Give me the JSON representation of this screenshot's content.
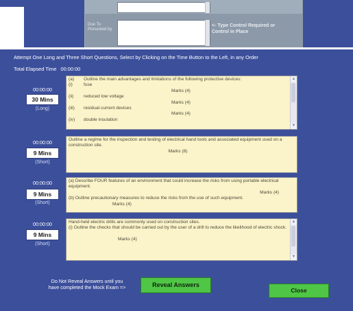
{
  "top": {
    "due_label": "Due To Presented by",
    "note": "<- Type Control Required or Control in Place"
  },
  "instructions": "Attempt One Long and Three Short Questions, Select by Clicking on the Time Button to the Left, in any Order",
  "elapsed": {
    "label": "Total Elapsed Time",
    "value": "00:00:00"
  },
  "questions": [
    {
      "timer": "00:00:00",
      "button": "30 Mins",
      "type": "(Long)",
      "lines": [
        {
          "num": "(a)",
          "text": "Outline the main advantages and limitations of the following protective devices:"
        },
        {
          "num": "(i)",
          "text": "fuse"
        },
        {
          "marks": "Marks (4)"
        },
        {
          "num": "(ii)",
          "text": "reduced low voltage"
        },
        {
          "marks": "Marks (4)"
        },
        {
          "num": "(iii)",
          "text": "residual current devices"
        },
        {
          "marks": "Marks (4)"
        },
        {
          "num": "(iv)",
          "text": "double insulation"
        }
      ]
    },
    {
      "timer": "00:00:00",
      "button": "9 Mins",
      "type": "(Short)",
      "text": "Outline a regime for the inspection and testing of electrical hand tools and associated equipment used on a construction site.",
      "marks": "Marks (8)"
    },
    {
      "timer": "00:00:00",
      "button": "9 Mins",
      "type": "(Short)",
      "line1": "(a) Describe FOUR features of an environment that could increase the risks from using portable electrical equipment.",
      "marks1": "Marks (4)",
      "line2": "(b) Outline precautionary measures to reduce the risks from the use of such equipment.",
      "marks2": "Marks (4)"
    },
    {
      "timer": "00:00:00",
      "button": "9 Mins",
      "type": "(Short)",
      "line1": "Hand-held electric drills are commonly used on construction sites.",
      "line2": "(i) Outline the checks that should be carried out by the user of a drill to reduce the likelihood of electric shock.",
      "marks1": "Marks (4)"
    }
  ],
  "footer": {
    "warning_line1": "Do Not Reveal Answers until you",
    "warning_line2": "have completed the Mock Exam =>",
    "reveal_label": "Reveal Answers",
    "close_label": "Close"
  },
  "colors": {
    "background": "#3c4f9b",
    "question_box": "#fbf3c9",
    "button_green": "#4fc646"
  }
}
